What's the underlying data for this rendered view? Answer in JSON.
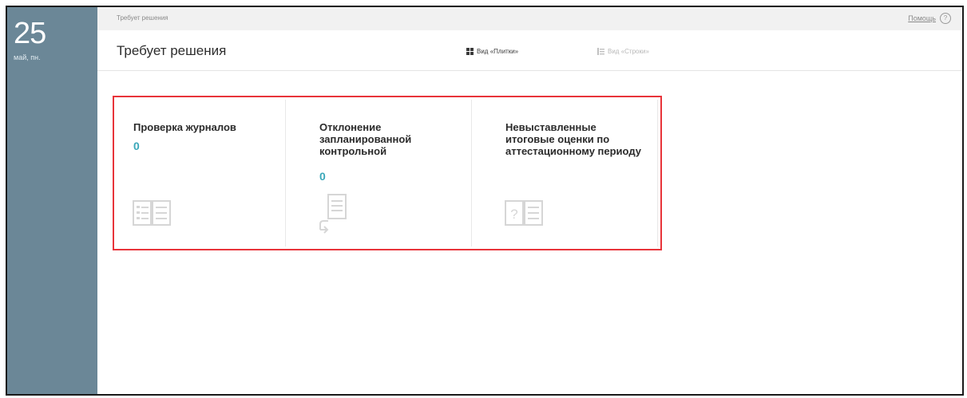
{
  "sidebar": {
    "day": "25",
    "sub": "май, пн."
  },
  "topbar": {
    "breadcrumb": "Требует решения",
    "help_label": "Помощь",
    "help_icon": "?"
  },
  "header": {
    "title": "Требует решения",
    "view_tiles_label": "Вид «Плитки»",
    "view_rows_label": "Вид «Строки»"
  },
  "cards": [
    {
      "title": "Проверка журналов",
      "count": "0",
      "icon": "journal-icon"
    },
    {
      "title": "Отклонение запланированной контрольной",
      "count": "0",
      "icon": "document-return-icon"
    },
    {
      "title": "Невыставленные итоговые оценки по аттестационному периоду",
      "count": "",
      "icon": "question-book-icon"
    }
  ],
  "colors": {
    "sidebar": "#6b8797",
    "accent": "#3aa7b9",
    "highlight": "#e8343a"
  }
}
